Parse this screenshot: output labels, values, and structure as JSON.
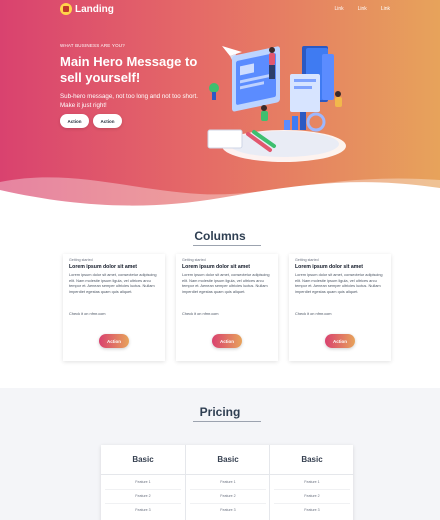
{
  "brand": {
    "name": "Landing"
  },
  "nav": {
    "links": [
      "Link",
      "Link",
      "Link"
    ]
  },
  "hero": {
    "eyebrow": "WHAT BUSINESS ARE YOU?",
    "title": "Main Hero Message to sell yourself!",
    "subtitle": "Sub-hero message, not too long and not too short. Make it just right!",
    "actions": [
      "Action",
      "Action"
    ]
  },
  "columns": {
    "title": "Columns",
    "cards": [
      {
        "eyebrow": "Getting started",
        "title": "Lorem ipsum dolor sit amet",
        "text": "Lorem ipsum dolor sit amet, consectetur adipiscing elit. Nam molestie ipsum ligula, vel ultrices arcu tempor et. Aenean semper ultricies luctus. Nullam imperdiet egestas quam quis aliquet.",
        "link": "Check it on nfmr.com",
        "action": "Action"
      },
      {
        "eyebrow": "Getting started",
        "title": "Lorem ipsum dolor sit amet",
        "text": "Lorem ipsum dolor sit amet, consectetur adipiscing elit. Nam molestie ipsum ligula, vel ultrices arcu tempor et. Aenean semper ultricies luctus. Nullam imperdiet egestas quam quis aliquet.",
        "link": "Check it on nfmr.com",
        "action": "Action"
      },
      {
        "eyebrow": "Getting started",
        "title": "Lorem ipsum dolor sit amet",
        "text": "Lorem ipsum dolor sit amet, consectetur adipiscing elit. Nam molestie ipsum ligula, vel ultrices arcu tempor et. Aenean semper ultricies luctus. Nullam imperdiet egestas quam quis aliquet.",
        "link": "Check it on nfmr.com",
        "action": "Action"
      }
    ]
  },
  "pricing": {
    "title": "Pricing",
    "plans": [
      {
        "name": "Basic",
        "features": [
          "Feature 1",
          "Feature 2",
          "Feature 3"
        ]
      },
      {
        "name": "Basic",
        "features": [
          "Feature 1",
          "Feature 2",
          "Feature 3"
        ]
      },
      {
        "name": "Basic",
        "features": [
          "Feature 1",
          "Feature 2",
          "Feature 3"
        ]
      }
    ]
  },
  "colors": {
    "gradient_start": "#d9426f",
    "gradient_end": "#e7a35b",
    "heading": "#2f3f52"
  }
}
